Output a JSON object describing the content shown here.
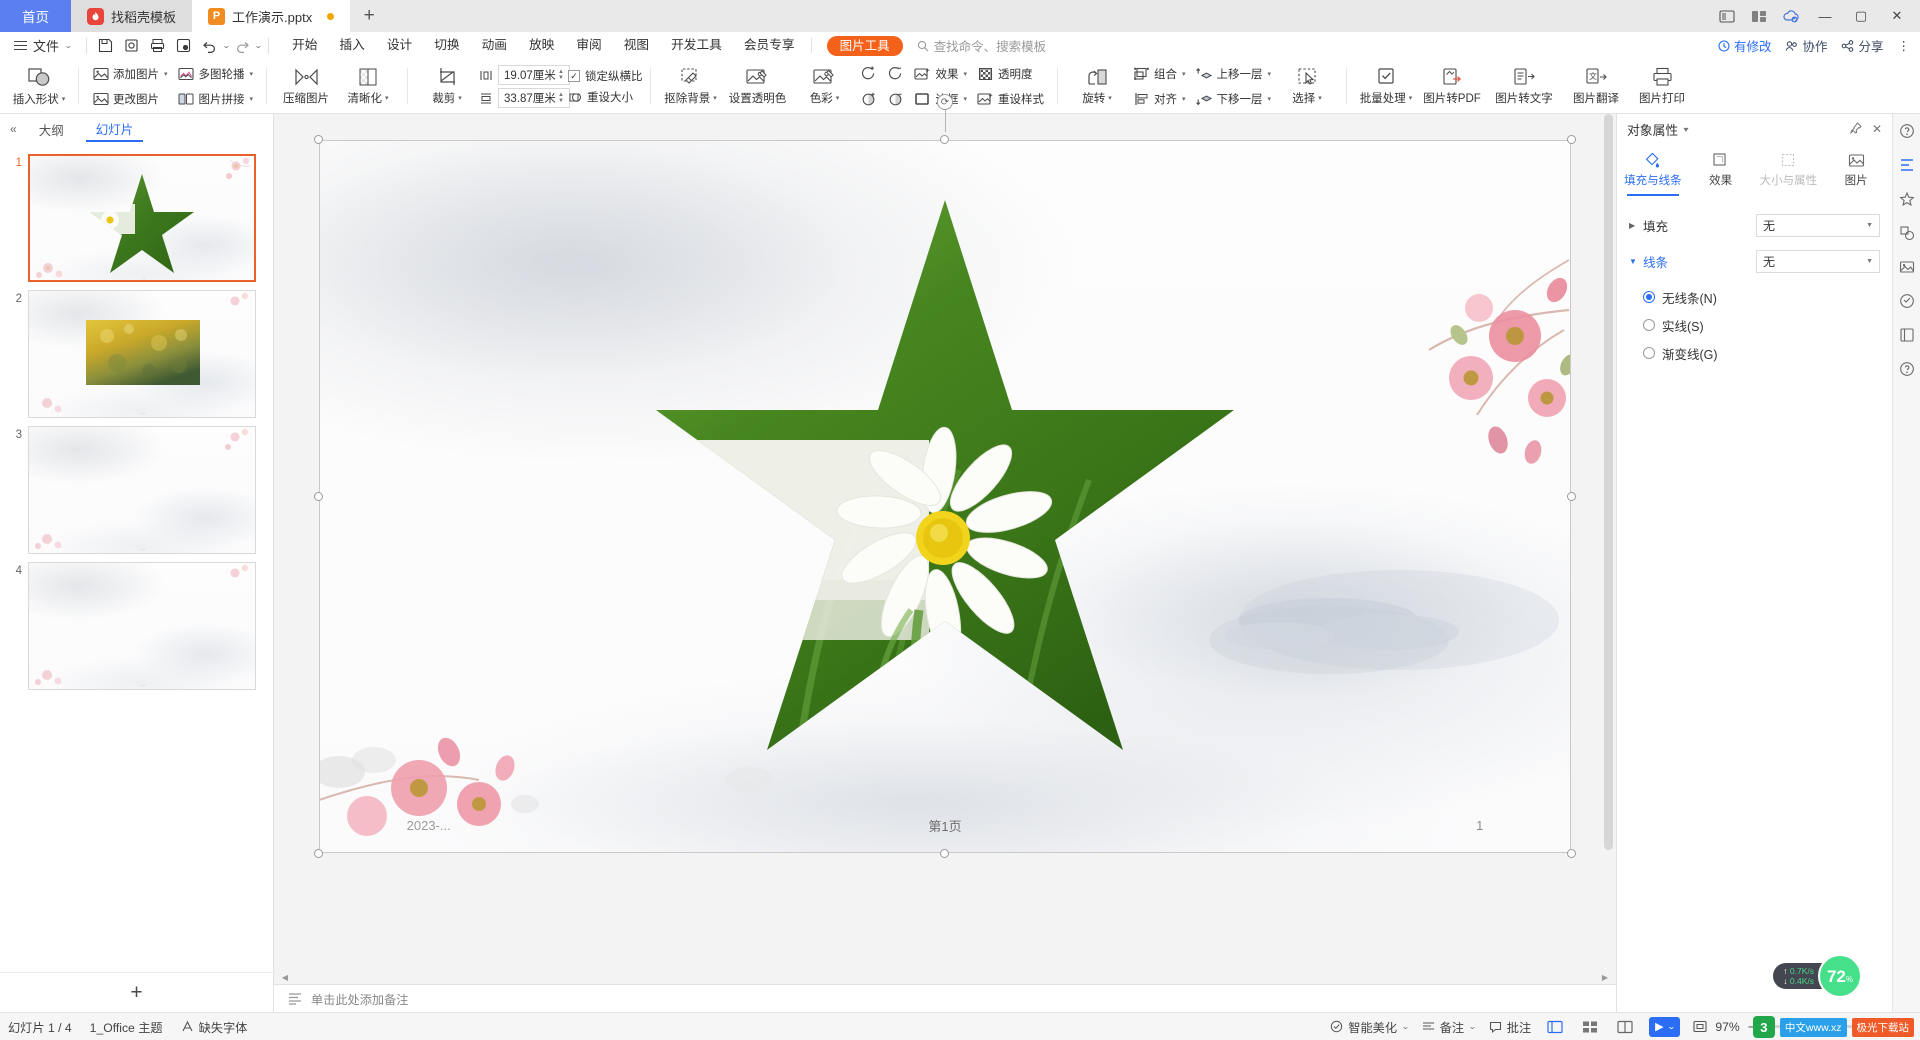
{
  "titlebar": {
    "tabs": [
      {
        "label": "首页",
        "type": "home",
        "icon": "home-icon"
      },
      {
        "label": "找稻壳模板",
        "type": "gray",
        "icon": "docer-icon"
      },
      {
        "label": "工作演示.pptx",
        "type": "active",
        "icon": "ppt-icon",
        "modified": true
      }
    ],
    "new_tab": "+",
    "right_icons": [
      "layout-single-icon",
      "layout-split-icon",
      "cloud-sync-icon"
    ],
    "window_buttons": {
      "minimize": "—",
      "maximize": "▢",
      "close": "✕"
    }
  },
  "menubar": {
    "file_label": "文件",
    "quick_icons": [
      "save-icon",
      "print-preview-icon",
      "print-icon",
      "export-pdf-icon",
      "undo-icon",
      "redo-icon",
      "customize-icon"
    ],
    "ribbon_tabs": [
      "开始",
      "插入",
      "设计",
      "切换",
      "动画",
      "放映",
      "审阅",
      "视图",
      "开发工具",
      "会员专享"
    ],
    "picture_tools_tab": "图片工具",
    "search_placeholder": "查找命令、搜索模板",
    "right_items": [
      {
        "label": "有修改",
        "icon": "edit-record-icon"
      },
      {
        "label": "协作",
        "icon": "collaborate-icon"
      },
      {
        "label": "分享",
        "icon": "share-icon"
      }
    ],
    "more": "⋮"
  },
  "toolbar": {
    "insert_shape": "插入形状",
    "groups": [
      {
        "items": [
          {
            "label": "添加图片",
            "icon": "add-picture-icon",
            "arrow": true
          },
          {
            "label": "更改图片",
            "icon": "change-picture-icon",
            "arrow": false
          },
          {
            "label": "多图轮播",
            "icon": "multi-picture-carousel-icon",
            "arrow": true
          },
          {
            "label": "图片拼接",
            "icon": "picture-collage-icon",
            "arrow": true
          }
        ]
      }
    ],
    "compress": "压缩图片",
    "clarity": "清晰化",
    "crop": "裁剪",
    "width_value": "19.07厘米",
    "height_value": "33.87厘米",
    "lock_ratio": "锁定纵横比",
    "lock_ratio_checked": true,
    "reset_size": "重设大小",
    "remove_bg": "抠除背景",
    "set_transparent": "设置透明色",
    "color": "色彩",
    "effects": "效果",
    "transparency": "透明度",
    "border": "边框",
    "reset_style": "重设样式",
    "rotate": "旋转",
    "align": "对齐",
    "group": "组合",
    "bring_forward": "上移一层",
    "send_backward": "下移一层",
    "select": "选择",
    "batch": "批量处理",
    "pic_to_pdf": "图片转PDF",
    "pic_to_text": "图片转文字",
    "pic_translate": "图片翻译",
    "pic_print": "图片打印"
  },
  "leftpane": {
    "collapse_icon": "collapse-icon",
    "tabs": [
      {
        "label": "大纲",
        "active": false
      },
      {
        "label": "幻灯片",
        "active": true
      }
    ],
    "slides": [
      {
        "number": "1",
        "selected": true,
        "has_star": true,
        "has_photo": false
      },
      {
        "number": "2",
        "selected": false,
        "has_star": false,
        "has_photo": true
      },
      {
        "number": "3",
        "selected": false,
        "has_star": false,
        "has_photo": false
      },
      {
        "number": "4",
        "selected": false,
        "has_star": false,
        "has_photo": false
      }
    ],
    "add_slide": "+"
  },
  "slide": {
    "footer_left": "2023-...",
    "footer_center": "第1页",
    "footer_right": "1"
  },
  "notes": {
    "icon": "notes-icon",
    "placeholder": "单击此处添加备注"
  },
  "rightpane": {
    "title": "对象属性",
    "title_caret": "▾",
    "pin_icon": "pin-icon",
    "close_icon": "close-icon",
    "tabs": [
      {
        "label": "填充与线条",
        "icon": "fill-line-icon",
        "active": true,
        "dim": false
      },
      {
        "label": "效果",
        "icon": "effects-icon",
        "active": false,
        "dim": false
      },
      {
        "label": "大小与属性",
        "icon": "size-props-icon",
        "active": false,
        "dim": true
      },
      {
        "label": "图片",
        "icon": "picture-icon",
        "active": false,
        "dim": false
      }
    ],
    "fill_label": "填充",
    "fill_value": "无",
    "line_label": "线条",
    "line_value": "无",
    "line_options": [
      {
        "label": "无线条(N)",
        "selected": true
      },
      {
        "label": "实线(S)",
        "selected": false
      },
      {
        "label": "渐变线(G)",
        "selected": false
      }
    ]
  },
  "rail": {
    "icons": [
      "help-circle-icon",
      "align-tools-icon",
      "star-tools-icon",
      "shapes-icon",
      "image-lib-icon",
      "location-icon",
      "frame-icon",
      "question-icon"
    ]
  },
  "status": {
    "slide_counter": "幻灯片 1 / 4",
    "theme": "1_Office 主题",
    "missing_font": "缺失字体",
    "beautify": "智能美化",
    "notes": "备注",
    "comments": "批注",
    "play": "▶",
    "zoom_percent": "97%",
    "zoom_minus": "−",
    "zoom_plus": "+",
    "view_icons": [
      "normal-view-icon",
      "sorter-view-icon",
      "reading-view-icon"
    ],
    "fullscreen_icon": "fullscreen-icon"
  },
  "netwidget": {
    "up_speed": "0.7K/s",
    "down_speed": "0.4K/s",
    "percent": "72",
    "percent_unit": "%"
  },
  "watermark": {
    "logo": "3",
    "text1": "中文www.xz",
    "text2": "极光下载站"
  },
  "colors": {
    "accent_blue": "#2b6ef5",
    "picture_tools_orange": "#f4611a",
    "home_tab_blue": "#5b7ff0",
    "selection_orange": "#e8622a",
    "star_green": "#3f7e1f"
  }
}
